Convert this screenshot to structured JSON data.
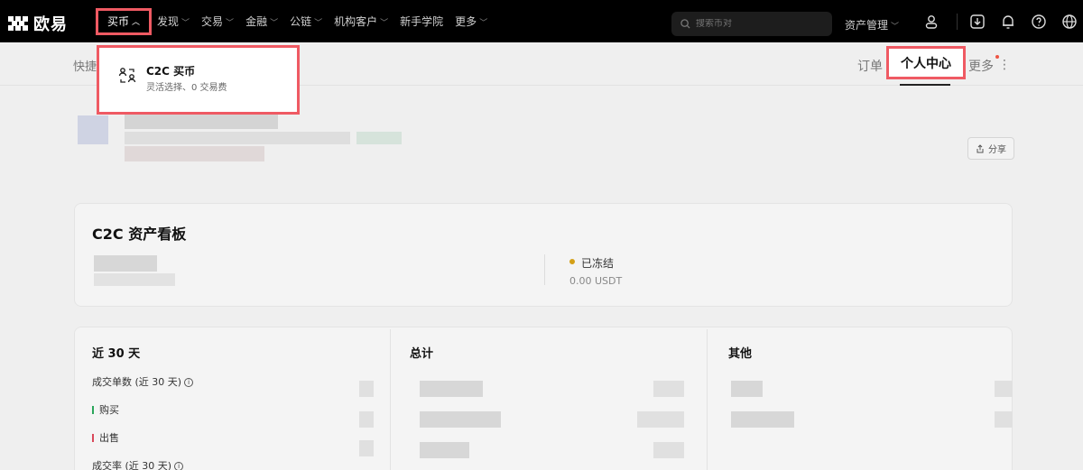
{
  "brand": {
    "name": "欧易"
  },
  "nav": {
    "buy": "买币",
    "discover": "发现",
    "trade": "交易",
    "finance": "金融",
    "chain": "公链",
    "institution": "机构客户",
    "academy": "新手学院",
    "more": "更多"
  },
  "search": {
    "placeholder": "搜索币对"
  },
  "header_right": {
    "asset_management": "资产管理"
  },
  "subnav": {
    "quick": "快捷",
    "orders": "订单",
    "personal_center": "个人中心",
    "more": "更多"
  },
  "share": {
    "label": "分享"
  },
  "asset_board": {
    "title": "C2C 资产看板",
    "frozen_label": "已冻结",
    "frozen_value": "0.00 USDT"
  },
  "stats": {
    "col1_title": "近 30 天",
    "col2_title": "总计",
    "col3_title": "其他",
    "rows": {
      "order_count": "成交单数 (近 30 天)",
      "buy": "购买",
      "sell": "出售",
      "completion_rate": "成交率 (近 30 天)"
    }
  },
  "dropdown": {
    "title": "C2C 买币",
    "subtitle": "灵活选择、0 交易费"
  },
  "colors": {
    "highlight": "#ef5a63",
    "buy": "#2aa55a",
    "sell": "#d9485a",
    "frozen": "#d4a017"
  }
}
